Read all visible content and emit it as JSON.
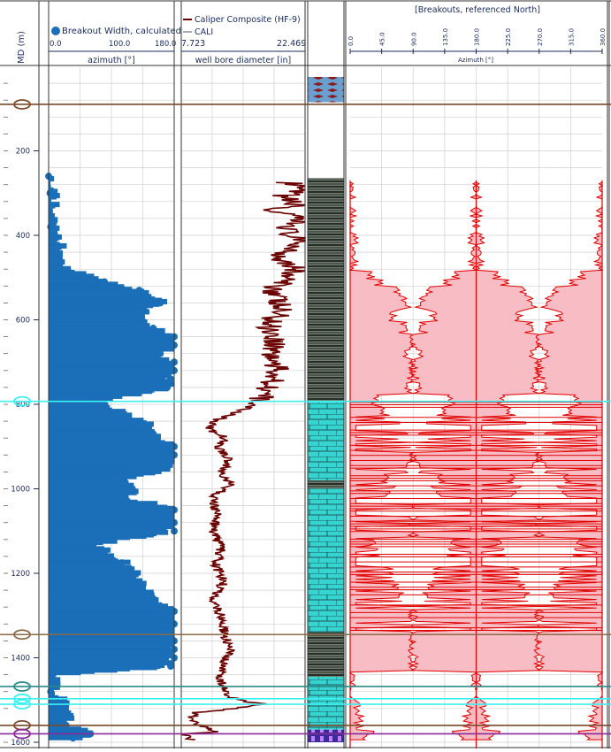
{
  "colors": {
    "grid": "#d0d0d0",
    "frame": "#333333",
    "axis_text": "#1a2a5a",
    "breakout_width": "#1a6fb8",
    "caliper": "#6b0000",
    "breakout_line": "#e00000",
    "breakout_fill": "#f8bcc4",
    "marker_brown": "#7a4a2a",
    "marker_tan": "#8b6a4a",
    "marker_cyan": "#3cf0f0",
    "marker_teal": "#2a8a8a",
    "marker_purple": "#8a2a9a",
    "litho_shale": "#6f7f6f",
    "litho_limestone": "#36d4d0",
    "litho_blue": "#6aa0d0"
  },
  "depth_track": {
    "label": "MD (m)",
    "ticks": [
      "200",
      "400",
      "600",
      "800",
      "1000",
      "1200",
      "1400",
      "1600"
    ]
  },
  "chart_data": [
    {
      "type": "scatter",
      "title": "",
      "legend": [
        "Breakout Width, calculated"
      ],
      "xlabel": "azimuth [°]",
      "xlim": [
        0,
        180
      ],
      "x_ticks": [
        "0.0",
        "100.0",
        "180.0"
      ],
      "ylabel": "MD (m)",
      "ylim": [
        0,
        1600
      ],
      "y_inverted": true,
      "series": [
        {
          "name": "Breakout Width, calculated",
          "points": [
            [
              0,
              260
            ],
            [
              2,
              300
            ],
            [
              3,
              380
            ],
            [
              12,
              430
            ],
            [
              8,
              470
            ],
            [
              60,
              500
            ],
            [
              80,
              510
            ],
            [
              130,
              530
            ],
            [
              160,
              560
            ],
            [
              120,
              590
            ],
            [
              150,
              620
            ],
            [
              180,
              640
            ],
            [
              180,
              660
            ],
            [
              160,
              680
            ],
            [
              180,
              700
            ],
            [
              180,
              720
            ],
            [
              175,
              740
            ],
            [
              170,
              760
            ],
            [
              70,
              790
            ],
            [
              100,
              820
            ],
            [
              140,
              850
            ],
            [
              150,
              870
            ],
            [
              180,
              900
            ],
            [
              180,
              920
            ],
            [
              170,
              950
            ],
            [
              100,
              980
            ],
            [
              120,
              1000
            ],
            [
              110,
              1020
            ],
            [
              180,
              1050
            ],
            [
              180,
              1080
            ],
            [
              180,
              1100
            ],
            [
              60,
              1130
            ],
            [
              80,
              1150
            ],
            [
              105,
              1175
            ],
            [
              120,
              1200
            ],
            [
              130,
              1230
            ],
            [
              150,
              1260
            ],
            [
              180,
              1290
            ],
            [
              180,
              1320
            ],
            [
              175,
              1340
            ],
            [
              180,
              1360
            ],
            [
              180,
              1380
            ],
            [
              180,
              1400
            ],
            [
              175,
              1420
            ],
            [
              5,
              1440
            ],
            [
              3,
              1480
            ],
            [
              20,
              1510
            ],
            [
              25,
              1560
            ],
            [
              60,
              1580
            ],
            [
              35,
              1590
            ]
          ]
        }
      ]
    },
    {
      "type": "line",
      "title": "",
      "legend": [
        "Caliper Composite (HF-9)",
        "CALI"
      ],
      "xlabel": "well bore diameter [in]",
      "xlim": [
        7.723,
        22.469
      ],
      "x_ticks": [
        "7.723",
        "22.469"
      ],
      "ylim": [
        0,
        1600
      ],
      "y_inverted": true,
      "series": [
        {
          "name": "Caliper Composite (HF-9)",
          "points": [
            [
              20.5,
              275
            ],
            [
              21.5,
              290
            ],
            [
              19.8,
              310
            ],
            [
              21.7,
              330
            ],
            [
              18.0,
              340
            ],
            [
              21.5,
              360
            ],
            [
              20.3,
              390
            ],
            [
              21.8,
              420
            ],
            [
              19.5,
              450
            ],
            [
              21.5,
              480
            ],
            [
              19.5,
              510
            ],
            [
              18.8,
              540
            ],
            [
              19.5,
              580
            ],
            [
              18.2,
              610
            ],
            [
              19.0,
              650
            ],
            [
              18.5,
              690
            ],
            [
              19.2,
              730
            ],
            [
              18.0,
              770
            ],
            [
              16.7,
              790
            ],
            [
              15.5,
              810
            ],
            [
              13.0,
              830
            ],
            [
              11.5,
              840
            ],
            [
              11.0,
              860
            ],
            [
              13.0,
              880
            ],
            [
              12.0,
              900
            ],
            [
              13.5,
              930
            ],
            [
              12.5,
              960
            ],
            [
              13.5,
              990
            ],
            [
              11.5,
              1020
            ],
            [
              12.0,
              1060
            ],
            [
              11.5,
              1100
            ],
            [
              12.5,
              1140
            ],
            [
              11.8,
              1180
            ],
            [
              12.8,
              1220
            ],
            [
              11.5,
              1260
            ],
            [
              12.5,
              1300
            ],
            [
              12.8,
              1340
            ],
            [
              13.5,
              1380
            ],
            [
              12.5,
              1420
            ],
            [
              12.5,
              1460
            ],
            [
              13.0,
              1490
            ],
            [
              16.0,
              1505
            ],
            [
              17.5,
              1510
            ],
            [
              14.0,
              1520
            ],
            [
              9.5,
              1530
            ],
            [
              8.5,
              1545
            ],
            [
              10.0,
              1560
            ],
            [
              12.0,
              1575
            ],
            [
              8.0,
              1580
            ],
            [
              9.0,
              1595
            ]
          ]
        },
        {
          "name": "CALI",
          "points": []
        }
      ]
    },
    {
      "type": "area",
      "title": "[Breakouts, referenced North]",
      "xlabel": "Azimuth [°]",
      "xlim": [
        0,
        360
      ],
      "x_ticks": [
        "0.0",
        "45.0",
        "90.0",
        "135.0",
        "180.0",
        "225.0",
        "270.0",
        "315.0",
        "360.0"
      ],
      "ylim": [
        0,
        1600
      ],
      "y_inverted": true,
      "series": [
        {
          "name": "Breakouts",
          "center_azimuths": [
            0,
            180,
            360
          ]
        }
      ]
    }
  ],
  "formation_markers": [
    {
      "depth": 90,
      "color": "#7a4a2a"
    },
    {
      "depth": 793,
      "color": "#3cf0f0"
    },
    {
      "depth": 1345,
      "color": "#8b6a4a"
    },
    {
      "depth": 1468,
      "color": "#2a8a8a"
    },
    {
      "depth": 1497,
      "color": "#3cf0f0"
    },
    {
      "depth": 1510,
      "color": "#3cf0f0"
    },
    {
      "depth": 1560,
      "color": "#7a4a2a"
    },
    {
      "depth": 1580,
      "color": "#8a2a9a"
    }
  ],
  "lithology": [
    {
      "top": 25,
      "base": 85,
      "type": "blue"
    },
    {
      "top": 265,
      "base": 795,
      "type": "shale"
    },
    {
      "top": 795,
      "base": 980,
      "type": "limestone"
    },
    {
      "top": 980,
      "base": 1000,
      "type": "shale"
    },
    {
      "top": 1000,
      "base": 1340,
      "type": "limestone"
    },
    {
      "top": 1340,
      "base": 1445,
      "type": "shale"
    },
    {
      "top": 1445,
      "base": 1570,
      "type": "limestone"
    },
    {
      "top": 1570,
      "base": 1600,
      "type": "blue"
    }
  ]
}
